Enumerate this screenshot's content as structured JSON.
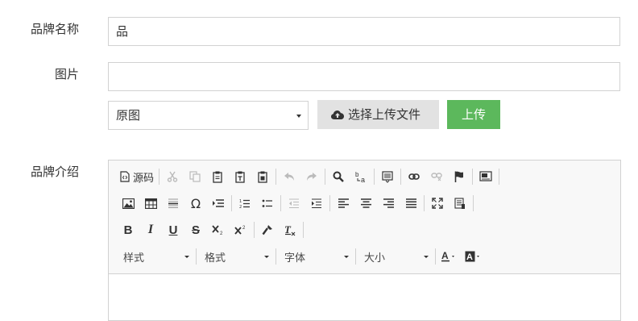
{
  "form": {
    "brand_name_label": "品牌名称",
    "brand_name_value": "品",
    "image_label": "图片",
    "image_value": "",
    "image_size_select": "原图",
    "choose_file_label": "选择上传文件",
    "upload_label": "上传",
    "intro_label": "品牌介绍"
  },
  "editor": {
    "source_label": "源码",
    "style_combo": "样式",
    "format_combo": "格式",
    "font_combo": "字体",
    "size_combo": "大小",
    "bold": "B",
    "italic": "I",
    "underline": "U",
    "strike": "S",
    "omega": "Ω"
  },
  "colors": {
    "upload_button": "#5cb85c",
    "file_button": "#e2e2e2",
    "toolbar_bg": "#f8f8f8"
  }
}
